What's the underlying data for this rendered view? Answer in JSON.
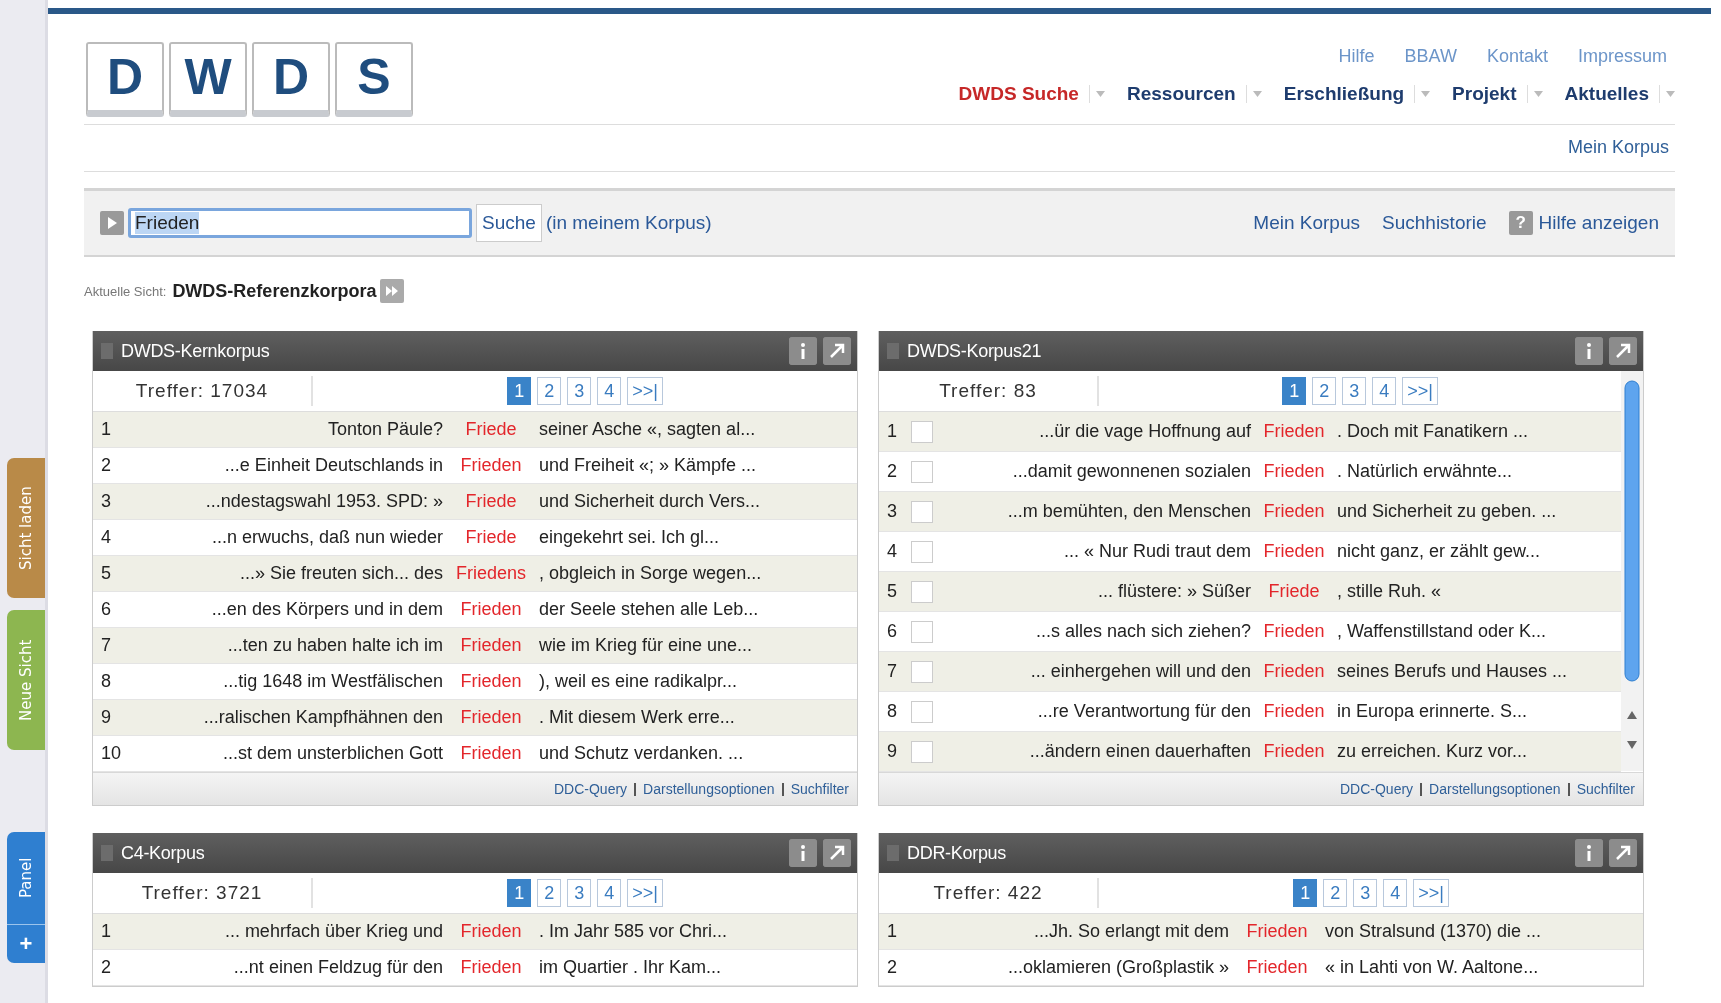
{
  "side_tabs": [
    {
      "label": "Sicht laden",
      "color": "#b98a48"
    },
    {
      "label": "Neue Sicht",
      "color": "#8db650"
    }
  ],
  "panel_tab": {
    "label": "Panel",
    "icon": "+"
  },
  "logo": [
    "D",
    "W",
    "D",
    "S"
  ],
  "top_links": [
    "Hilfe",
    "BBAW",
    "Kontakt",
    "Impressum"
  ],
  "nav": [
    {
      "label": "DWDS Suche",
      "selected": true
    },
    {
      "label": "Ressourcen",
      "selected": false
    },
    {
      "label": "Erschließung",
      "selected": false
    },
    {
      "label": "Projekt",
      "selected": false
    },
    {
      "label": "Aktuelles",
      "selected": false
    }
  ],
  "sub_nav": "Mein Korpus",
  "search": {
    "value": "Frieden",
    "button": "Suche",
    "scope": "(in meinem Korpus)",
    "links": [
      "Mein Korpus",
      "Suchhistorie"
    ],
    "help_icon": "?",
    "help": "Hilfe anzeigen"
  },
  "current_view": {
    "label": "Aktuelle Sicht:",
    "value": "DWDS-Referenzkorpora"
  },
  "panels": [
    {
      "title": "DWDS-Kernkorpus",
      "hits": "Treffer: 17034",
      "pages": [
        {
          "label": "1",
          "selected": true
        },
        {
          "label": "2",
          "selected": false
        },
        {
          "label": "3",
          "selected": false
        },
        {
          "label": "4",
          "selected": false
        },
        {
          "label": ">>|",
          "selected": false
        }
      ],
      "rows": [
        {
          "num": "1",
          "left": "Tonton Päule?",
          "match": "Friede",
          "right": "seiner Asche «, sagten al..."
        },
        {
          "num": "2",
          "left": "...e Einheit Deutschlands in",
          "match": "Frieden",
          "right": "und Freiheit «; » Kämpfe ..."
        },
        {
          "num": "3",
          "left": "...ndestagswahl 1953. SPD: »",
          "match": "Friede",
          "right": "und Sicherheit durch Vers..."
        },
        {
          "num": "4",
          "left": "...n erwuchs, daß nun wieder",
          "match": "Friede",
          "right": "eingekehrt sei. Ich gl..."
        },
        {
          "num": "5",
          "left": "...» Sie freuten sich... des",
          "match": "Friedens",
          "right": ", obgleich in Sorge wegen..."
        },
        {
          "num": "6",
          "left": "...en des Körpers und in dem",
          "match": "Frieden",
          "right": "der Seele stehen alle Leb..."
        },
        {
          "num": "7",
          "left": "...ten zu haben halte ich im",
          "match": "Frieden",
          "right": "wie im Krieg für eine une..."
        },
        {
          "num": "8",
          "left": "...tig 1648 im Westfälischen",
          "match": "Frieden",
          "right": "), weil es eine radikalpr..."
        },
        {
          "num": "9",
          "left": "...ralischen Kampfhähnen den",
          "match": "Frieden",
          "right": ". Mit diesem Werk erre..."
        },
        {
          "num": "10",
          "left": "...st dem unsterblichen Gott",
          "match": "Frieden",
          "right": "und Schutz verdanken. ..."
        }
      ],
      "footer_links": [
        "DDC-Query",
        "Darstellungsoptionen",
        "Suchfilter"
      ]
    },
    {
      "title": "DWDS-Korpus21",
      "hits": "Treffer: 83",
      "scrollbar": true,
      "pages": [
        {
          "label": "1",
          "selected": true
        },
        {
          "label": "2",
          "selected": false
        },
        {
          "label": "3",
          "selected": false
        },
        {
          "label": "4",
          "selected": false
        },
        {
          "label": ">>|",
          "selected": false
        }
      ],
      "rows": [
        {
          "num": "1",
          "checked": false,
          "left": "...ür die vage Hoffnung auf",
          "match": "Frieden",
          "right": ". Doch mit Fanatikern ..."
        },
        {
          "num": "2",
          "checked": false,
          "left": "...damit gewonnenen sozialen",
          "match": "Frieden",
          "right": ". Natürlich erwähnte..."
        },
        {
          "num": "3",
          "checked": false,
          "left": "...m bemühten, den Menschen",
          "match": "Frieden",
          "right": "und Sicherheit zu geben. ..."
        },
        {
          "num": "4",
          "checked": false,
          "left": "... « Nur Rudi traut dem",
          "match": "Frieden",
          "right": "nicht ganz, er zählt gew..."
        },
        {
          "num": "5",
          "checked": false,
          "left": "... flüstere: » Süßer",
          "match": "Friede",
          "right": ", stille Ruh. «"
        },
        {
          "num": "6",
          "checked": false,
          "left": "...s alles nach sich ziehen?",
          "match": "Frieden",
          "right": ", Waffenstillstand oder K..."
        },
        {
          "num": "7",
          "checked": false,
          "left": "... einhergehen will und den",
          "match": "Frieden",
          "right": "seines Berufs und Hauses ..."
        },
        {
          "num": "8",
          "checked": false,
          "left": "...re Verantwortung für den",
          "match": "Frieden",
          "right": "in Europa erinnerte. S..."
        },
        {
          "num": "9",
          "checked": false,
          "left": "...ändern einen dauerhaften",
          "match": "Frieden",
          "right": "zu erreichen. Kurz vor..."
        }
      ],
      "footer_links": [
        "DDC-Query",
        "Darstellungsoptionen",
        "Suchfilter"
      ]
    },
    {
      "title": "C4-Korpus",
      "hits": "Treffer: 3721",
      "pages": [
        {
          "label": "1",
          "selected": true
        },
        {
          "label": "2",
          "selected": false
        },
        {
          "label": "3",
          "selected": false
        },
        {
          "label": "4",
          "selected": false
        },
        {
          "label": ">>|",
          "selected": false
        }
      ],
      "rows": [
        {
          "num": "1",
          "left": "... mehrfach über Krieg und",
          "match": "Frieden",
          "right": ". Im Jahr 585 vor Chri..."
        },
        {
          "num": "2",
          "left": "...nt einen Feldzug für den",
          "match": "Frieden",
          "right": "im Quartier . Ihr Kam..."
        }
      ]
    },
    {
      "title": "DDR-Korpus",
      "hits": "Treffer: 422",
      "pages": [
        {
          "label": "1",
          "selected": true
        },
        {
          "label": "2",
          "selected": false
        },
        {
          "label": "3",
          "selected": false
        },
        {
          "label": "4",
          "selected": false
        },
        {
          "label": ">>|",
          "selected": false
        }
      ],
      "rows": [
        {
          "num": "1",
          "left": "...Jh. So erlangt mit dem",
          "match": "Frieden",
          "right": "von Stralsund (1370) die ..."
        },
        {
          "num": "2",
          "left": "...oklamieren (Großplastik »",
          "match": "Frieden",
          "right": "« in Lahti von W. Aaltone..."
        }
      ]
    }
  ]
}
